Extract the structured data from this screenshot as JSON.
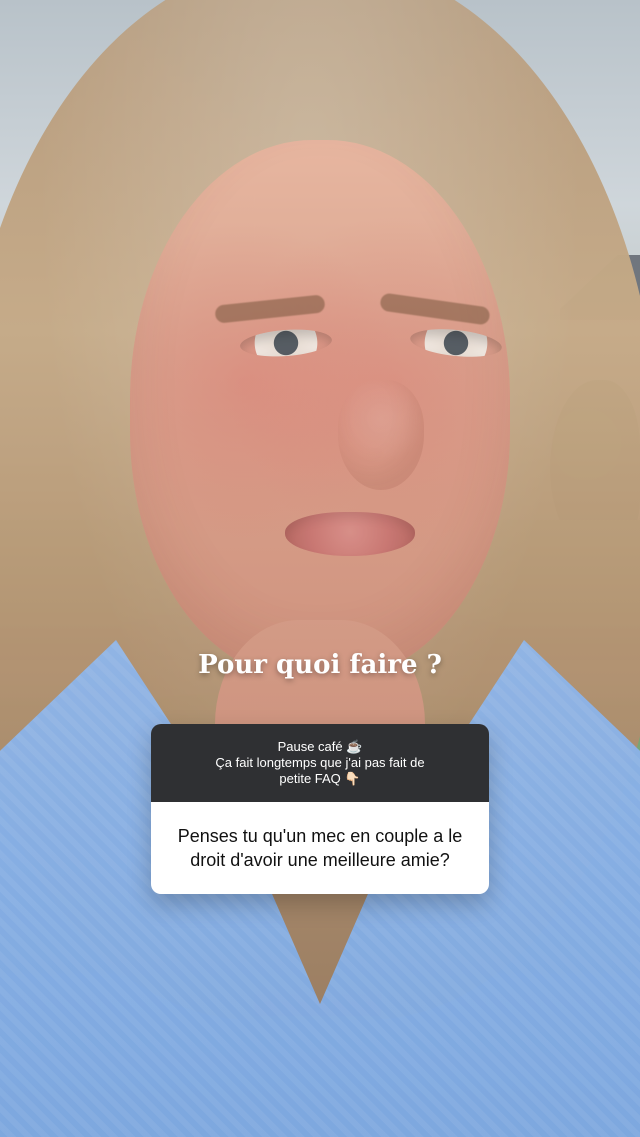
{
  "overlay": {
    "prompt": "Pour quoi faire ?",
    "card": {
      "header_line1": "Pause café ☕",
      "header_line2": "Ça fait longtemps que j'ai pas fait de",
      "header_line3": "petite FAQ 👇🏻",
      "question_text": "Penses tu qu'un mec en couple a le droit d'avoir une meilleure amie?"
    }
  }
}
